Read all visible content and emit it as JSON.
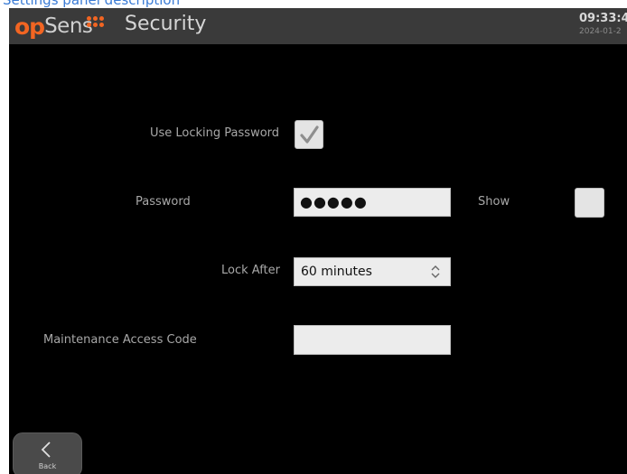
{
  "top_strip_text": "Settings panel description",
  "header": {
    "logo_op": "op",
    "logo_sens": "Sens",
    "title": "Security",
    "time": "09:33:4",
    "date": "2024-01-2"
  },
  "form": {
    "use_locking_password": {
      "label": "Use Locking Password",
      "checked": true
    },
    "password": {
      "label": "Password",
      "value": "●●●●●"
    },
    "show": {
      "label": "Show",
      "checked": false
    },
    "lock_after": {
      "label": "Lock After",
      "value": "60 minutes"
    },
    "maintenance_access_code": {
      "label": "Maintenance Access Code",
      "value": ""
    }
  },
  "footer": {
    "back_label": "Back"
  },
  "colors": {
    "brand_orange": "#f26522",
    "background": "#000000",
    "header_bg": "#3a3a3a",
    "field_bg": "#ececec",
    "label_text": "#a8a8a8"
  },
  "icons": {
    "check": "checkmark-icon",
    "select_arrows": "updown-chevron-icon",
    "back": "chevron-left-icon"
  }
}
